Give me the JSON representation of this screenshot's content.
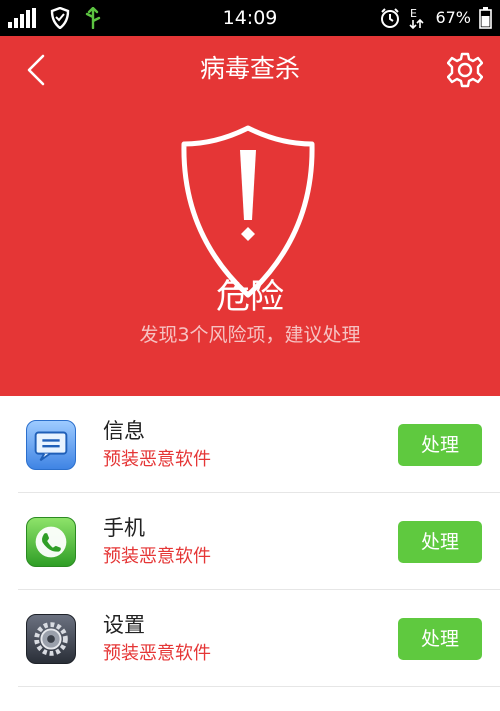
{
  "status_bar": {
    "time": "14:09",
    "battery_text": "67%",
    "icons": [
      "signal-icon",
      "shield-status-icon",
      "usb-icon",
      "alarm-icon",
      "data-icon",
      "battery-icon"
    ]
  },
  "header": {
    "title": "病毒查杀",
    "back_icon": "chevron-left-icon",
    "settings_icon": "gear-icon"
  },
  "summary": {
    "level": "危险",
    "description": "发现3个风险项，建议处理",
    "icon": "danger-shield-icon"
  },
  "threats": [
    {
      "name": "信息",
      "risk": "预装恶意软件",
      "action": "处理",
      "icon": "messages-app-icon"
    },
    {
      "name": "手机",
      "risk": "预装恶意软件",
      "action": "处理",
      "icon": "phone-app-icon"
    },
    {
      "name": "设置",
      "risk": "预装恶意软件",
      "action": "处理",
      "icon": "settings-app-icon"
    }
  ],
  "colors": {
    "accent": "#e53636",
    "action": "#5fc93f"
  }
}
